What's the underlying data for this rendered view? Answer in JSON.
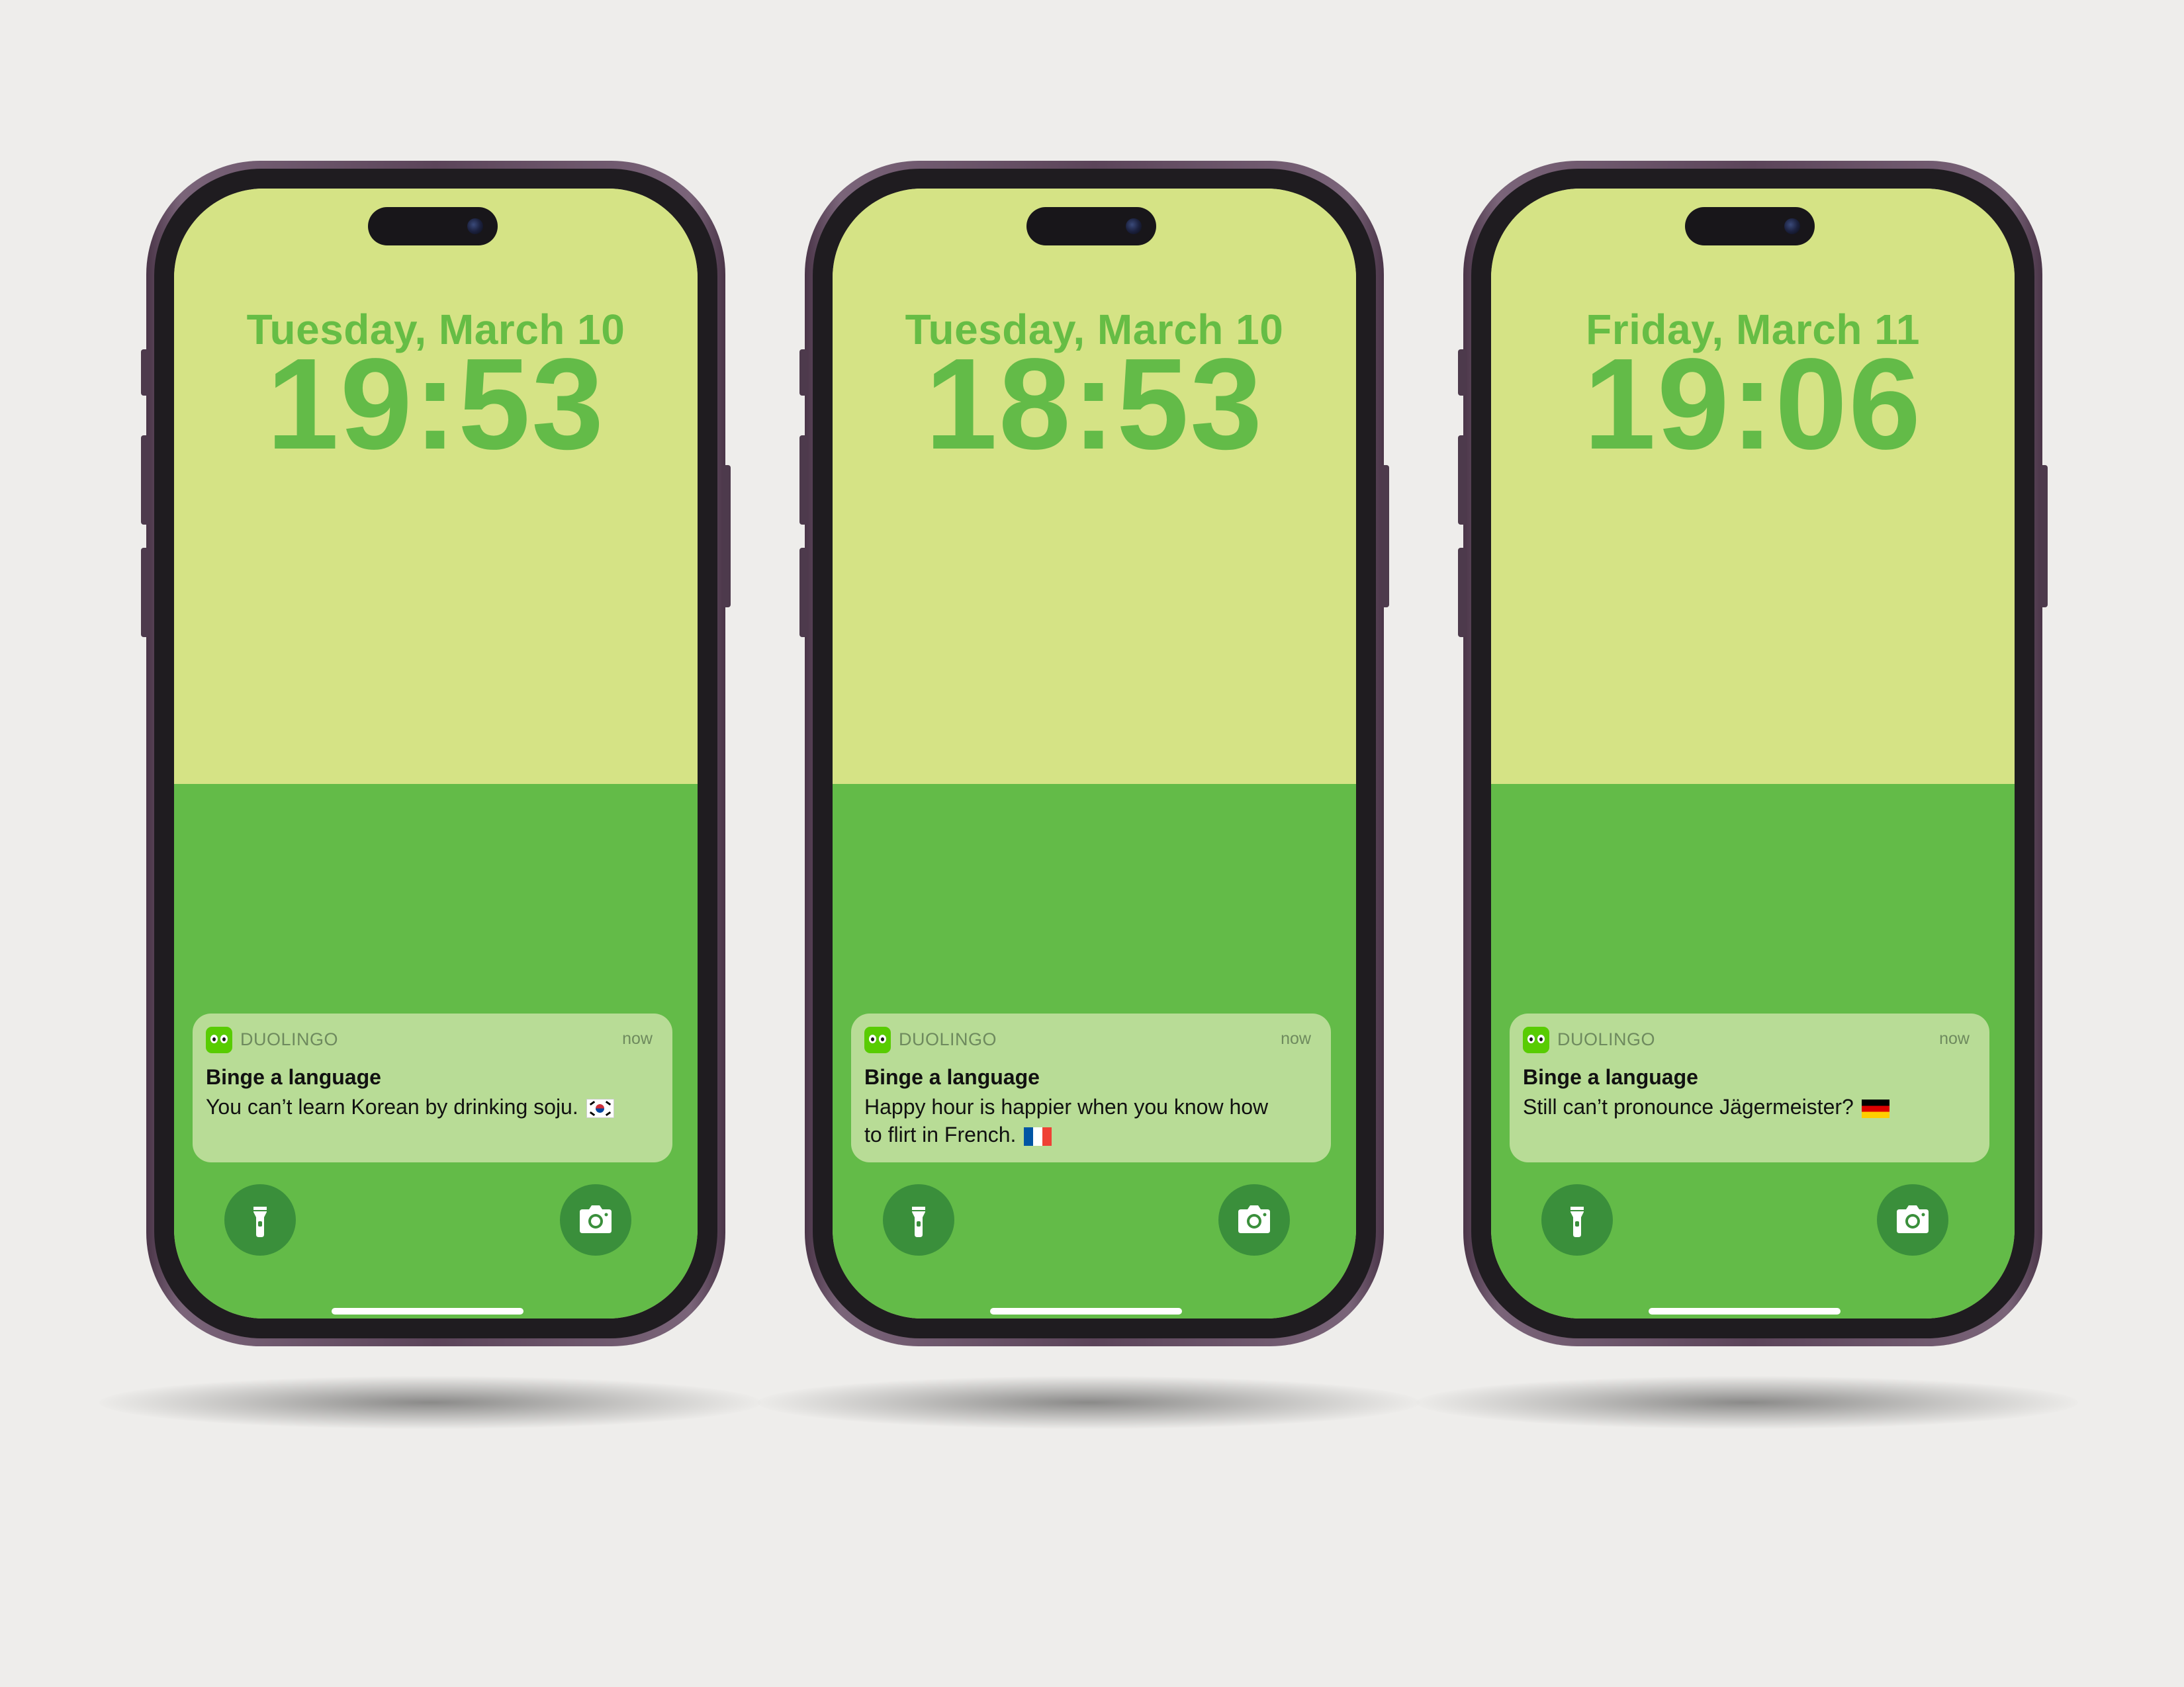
{
  "phones": [
    {
      "date": "Tuesday, March 10",
      "time": "19:53",
      "notification": {
        "app": "DUOLINGO",
        "timestamp": "now",
        "title": "Binge a language",
        "body": "You can’t learn Korean by drinking soju.",
        "flag": "south-korea-flag-icon"
      }
    },
    {
      "date": "Tuesday, March 10",
      "time": "18:53",
      "notification": {
        "app": "DUOLINGO",
        "timestamp": "now",
        "title": "Binge a language",
        "body": "Happy hour is happier when you know how to flirt in French.",
        "flag": "france-flag-icon"
      }
    },
    {
      "date": "Friday, March 11",
      "time": "19:06",
      "notification": {
        "app": "DUOLINGO",
        "timestamp": "now",
        "title": "Binge a language",
        "body": "Still can’t pronounce Jägermeister?",
        "flag": "germany-flag-icon"
      }
    }
  ],
  "icons": {
    "left_button": "flashlight-icon",
    "right_button": "camera-icon",
    "app_icon": "duolingo-owl-icon"
  },
  "colors": {
    "background": "#eeedeb",
    "wallpaper_top": "#d5e385",
    "wallpaper_bottom": "#63bb48",
    "clock_text": "#63bb48",
    "notification_bg": "#b8dc96",
    "quick_button": "#3a8f3b",
    "phone_frame": "#5b4459"
  }
}
